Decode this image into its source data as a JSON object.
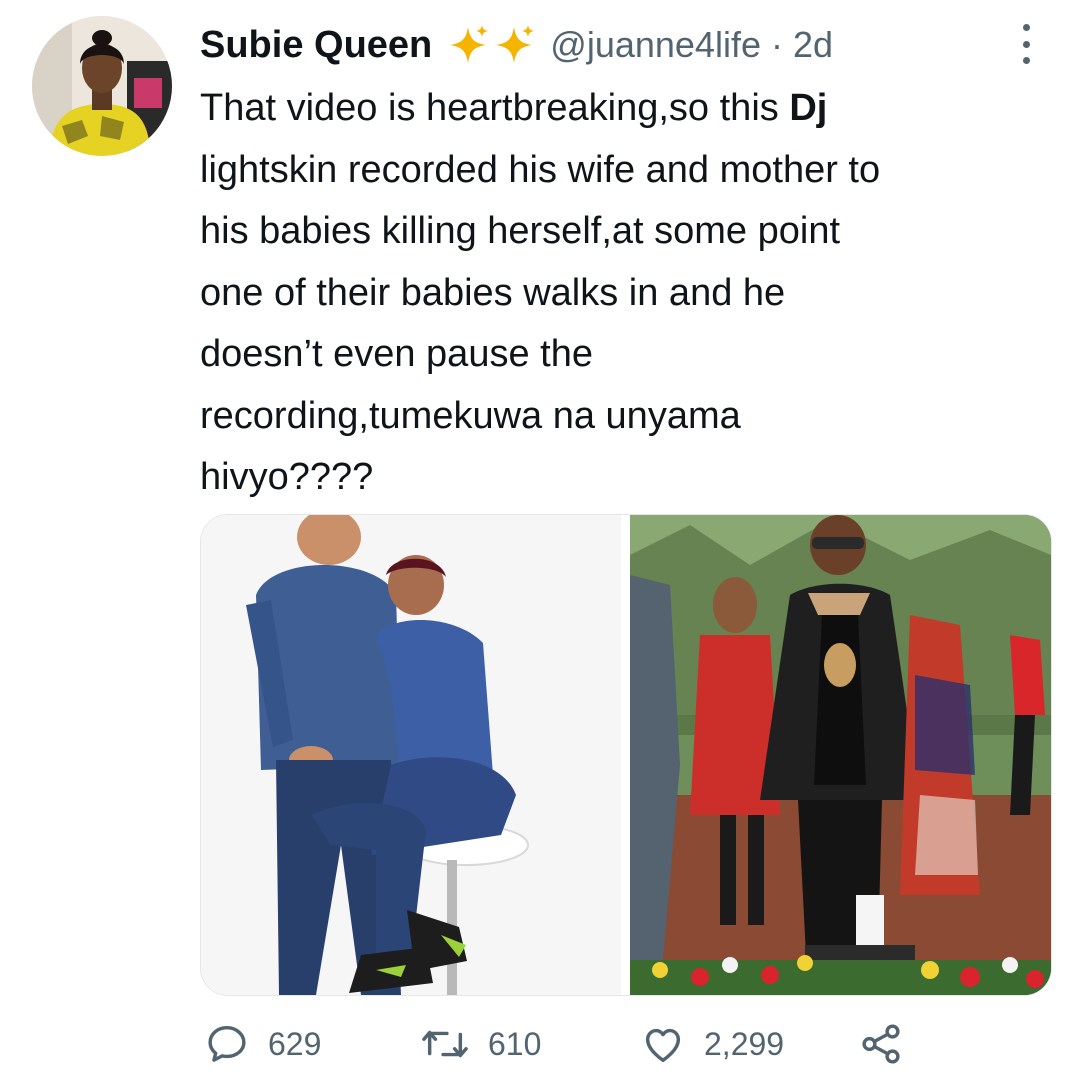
{
  "user": {
    "display_name": "Subie Queen",
    "badge_emoji": "✨✨",
    "handle": "@juanne4life",
    "separator": "·",
    "time": "2d"
  },
  "tweet": {
    "lines": [
      {
        "pre": "That video is heartbreaking,so this ",
        "bold": "Dj"
      },
      {
        "text": "lightskin recorded his wife and mother to"
      },
      {
        "text": "his babies killing herself,at some point"
      },
      {
        "text": "one of their babies walks in and he"
      },
      {
        "text": "doesn’t even pause the"
      },
      {
        "text": "recording,tumekuwa na unyama"
      },
      {
        "text": "hivyo????"
      }
    ]
  },
  "media": {
    "photo_count": 2
  },
  "actions": {
    "replies": "629",
    "retweets": "610",
    "likes": "2,299"
  },
  "icons": {
    "reply": "reply-icon",
    "retweet": "retweet-icon",
    "like": "heart-icon",
    "share": "share-icon",
    "more": "more-options-icon",
    "badge": "sparkles-icon"
  },
  "colors": {
    "text_primary": "#0f1419",
    "text_secondary": "#536471",
    "sparkle": "#f4b400"
  }
}
